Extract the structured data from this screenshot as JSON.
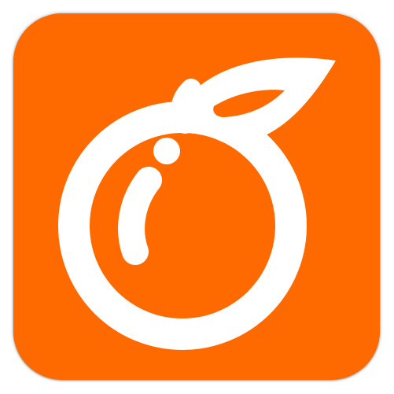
{
  "app_icon": {
    "icon_name": "orange-fruit-icon",
    "background_color": "#FF6A00",
    "glyph_color": "#FFFFFF"
  }
}
